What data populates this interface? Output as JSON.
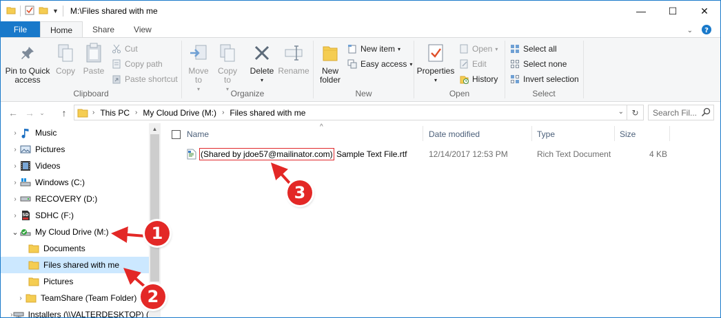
{
  "window": {
    "title": "M:\\Files shared with me",
    "controls": {
      "minimize": "—",
      "maximize": "☐",
      "close": "✕"
    }
  },
  "ribbon_tabs": [
    {
      "label": "File"
    },
    {
      "label": "Home"
    },
    {
      "label": "Share"
    },
    {
      "label": "View"
    }
  ],
  "ribbon": {
    "clipboard": {
      "label": "Clipboard",
      "pin": "Pin to Quick access",
      "copy": "Copy",
      "paste": "Paste",
      "cut": "Cut",
      "copy_path": "Copy path",
      "paste_shortcut": "Paste shortcut"
    },
    "organize": {
      "label": "Organize",
      "move_to": "Move to",
      "copy_to": "Copy to",
      "delete": "Delete",
      "rename": "Rename"
    },
    "new": {
      "label": "New",
      "new_folder": "New folder",
      "new_item": "New item",
      "easy_access": "Easy access"
    },
    "open": {
      "label": "Open",
      "properties": "Properties",
      "open": "Open",
      "edit": "Edit",
      "history": "History"
    },
    "select": {
      "label": "Select",
      "select_all": "Select all",
      "select_none": "Select none",
      "invert": "Invert selection"
    }
  },
  "address": {
    "breadcrumbs": [
      "This PC",
      "My Cloud Drive (M:)",
      "Files shared with me"
    ],
    "search_placeholder": "Search Fil..."
  },
  "nav_tree": [
    {
      "label": "Music",
      "icon": "music-icon"
    },
    {
      "label": "Pictures",
      "icon": "pictures-icon"
    },
    {
      "label": "Videos",
      "icon": "videos-icon"
    },
    {
      "label": "Windows (C:)",
      "icon": "drive-icon"
    },
    {
      "label": "RECOVERY (D:)",
      "icon": "drive-icon"
    },
    {
      "label": "SDHC (F:)",
      "icon": "sd-card-icon"
    },
    {
      "label": "My Cloud Drive (M:)",
      "icon": "cloud-drive-icon"
    },
    {
      "label": "Documents",
      "icon": "folder-icon"
    },
    {
      "label": "Files shared with me",
      "icon": "folder-icon"
    },
    {
      "label": "Pictures",
      "icon": "folder-icon"
    },
    {
      "label": "TeamShare (Team Folder)",
      "icon": "folder-icon"
    },
    {
      "label": "Installers (\\\\VALTERDESKTOP) (",
      "icon": "network-drive-icon"
    }
  ],
  "columns": {
    "name": "Name",
    "date": "Date modified",
    "type": "Type",
    "size": "Size"
  },
  "files": [
    {
      "name_prefix": "(Shared by jdoe57@mailinator.com)",
      "name_rest": " Sample Text File.rtf",
      "date": "12/14/2017 12:53 PM",
      "type": "Rich Text Document",
      "size": "4 KB"
    }
  ],
  "annotations": {
    "m1": "1",
    "m2": "2",
    "m3": "3"
  },
  "colors": {
    "accent": "#1979ca",
    "marker": "#e32826",
    "selection": "#cce8ff"
  }
}
